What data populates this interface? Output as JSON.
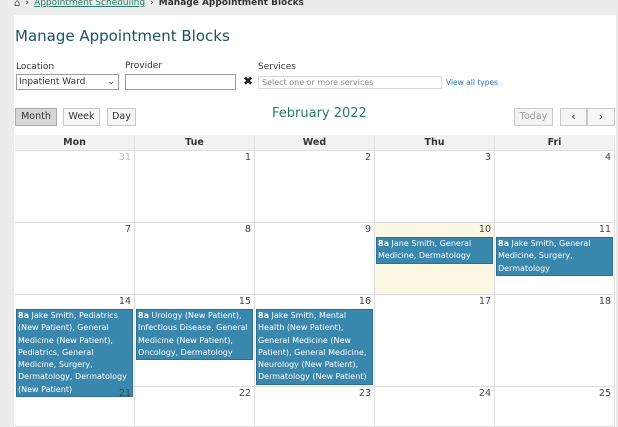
{
  "breadcrumb": {
    "home_icon": "home-icon",
    "link": "Appointment Scheduling",
    "current": "Manage Appointment Blocks"
  },
  "page_title": "Manage Appointment Blocks",
  "filters": {
    "location_label": "Location",
    "location_value": "Inpatient Ward",
    "provider_label": "Provider",
    "provider_value": "",
    "services_label": "Services",
    "services_placeholder": "Select one or more services",
    "view_all": "View all types"
  },
  "toolbar": {
    "month": "Month",
    "week": "Week",
    "day": "Day",
    "title": "February 2022",
    "today": "Today",
    "prev_icon": "chevron-left-icon",
    "next_icon": "chevron-right-icon"
  },
  "calendar": {
    "days": [
      "Mon",
      "Tue",
      "Wed",
      "Thu",
      "Fri"
    ],
    "weeks": [
      {
        "dates": [
          "31",
          "1",
          "2",
          "3",
          "4"
        ]
      },
      {
        "dates": [
          "7",
          "8",
          "9",
          "10",
          "11"
        ]
      },
      {
        "dates": [
          "14",
          "15",
          "16",
          "17",
          "18"
        ]
      },
      {
        "dates": [
          "21",
          "22",
          "23",
          "24",
          "25"
        ]
      }
    ],
    "events": {
      "thu10": {
        "time": "8a",
        "text": "Jane Smith, General Medicine, Dermatology"
      },
      "fri11": {
        "time": "8a",
        "text": "Jake Smith, General Medicine, Surgery, Dermatology"
      },
      "mon14": {
        "time": "8a",
        "text": "Jake Smith, Pediatrics (New Patient), General Medicine (New Patient), Pediatrics, General Medicine, Surgery, Dermatology, Dermatology (New Patient)"
      },
      "tue15": {
        "time": "8a",
        "text": "Urology (New Patient), Infectious Disease, General Medicine (New Patient), Oncology, Dermatology"
      },
      "wed16": {
        "time": "8a",
        "text": "Jake Smith, Mental Health (New Patient), General Medicine (New Patient), General Medicine, Neurology (New Patient), Dermatology (New Patient)"
      }
    }
  },
  "colors": {
    "event_bg": "#3a87ad",
    "today_bg": "#fcf8e3",
    "accent": "#2a7b6e"
  }
}
